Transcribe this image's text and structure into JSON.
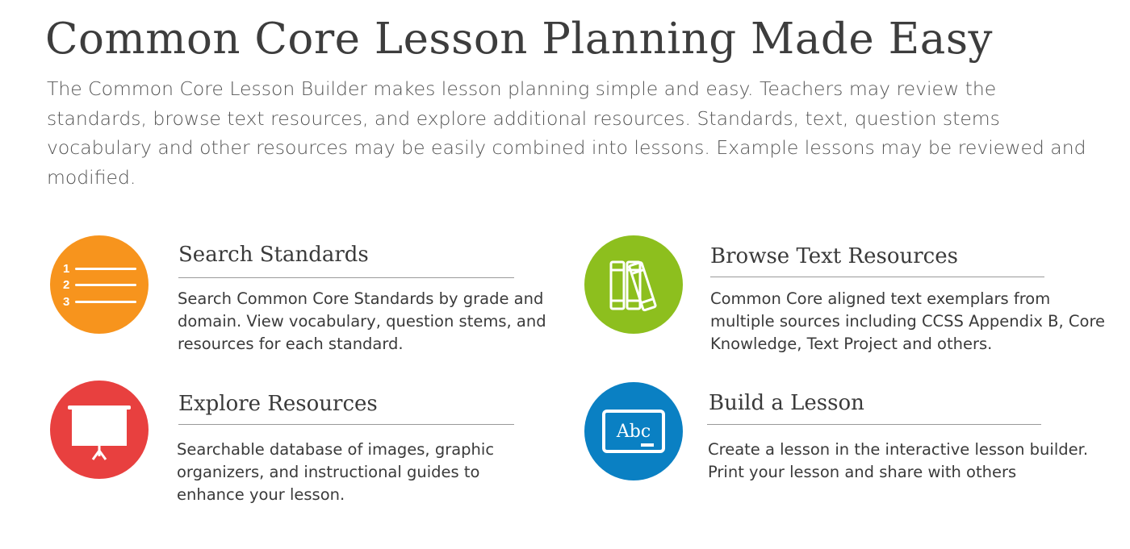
{
  "title": "Common Core Lesson Planning Made Easy",
  "intro": "The Common Core Lesson Builder makes lesson planning simple and easy. Teachers may review the standards, browse text resources, and explore additional resources.  Standards, text, question stems vocabulary and other resources may be easily combined into lessons. Example lessons may be reviewed and modified.",
  "features": {
    "search_standards": {
      "title": "Search Standards",
      "description": "Search Common Core Standards by grade and domain.  View vocabulary, question stems, and resources for each standard.",
      "icon": "numbered-list-icon",
      "icon_labels": [
        "1",
        "2",
        "3"
      ],
      "color": "#f7941d"
    },
    "browse_text": {
      "title": "Browse Text Resources",
      "description": "Common Core aligned text exemplars from multiple sources including CCSS Appendix B, Core Knowledge, Text Project and others.",
      "icon": "books-icon",
      "color": "#8dbf1e"
    },
    "explore_resources": {
      "title": "Explore Resources",
      "description": "Searchable database of  images, graphic organizers, and instructional guides to enhance your lesson.",
      "icon": "projector-screen-icon",
      "color": "#e8403f"
    },
    "build_lesson": {
      "title": "Build a Lesson",
      "description": "Create a  lesson in the interactive lesson builder. Print your lesson and share with others",
      "icon": "chalkboard-icon",
      "icon_text": "Abc",
      "color": "#0a80c3"
    }
  }
}
